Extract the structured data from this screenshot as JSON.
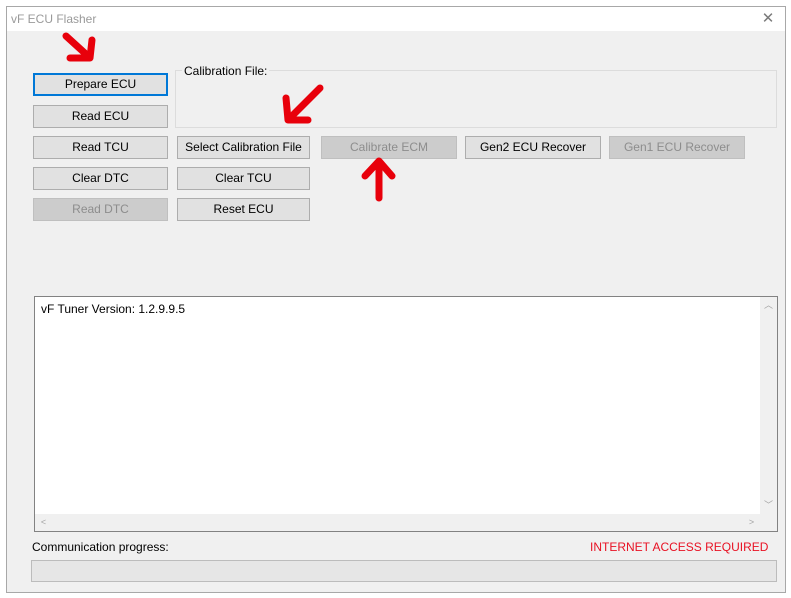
{
  "window": {
    "title": "vF ECU Flasher",
    "close_glyph": "✕"
  },
  "buttons": {
    "prepare_ecu": "Prepare ECU",
    "read_ecu": "Read ECU",
    "read_tcu": "Read TCU",
    "clear_dtc": "Clear DTC",
    "read_dtc": "Read DTC",
    "select_calibration_file": "Select Calibration File",
    "clear_tcu": "Clear TCU",
    "reset_ecu": "Reset ECU",
    "calibrate_ecm": "Calibrate ECM",
    "gen2_ecu_recover": "Gen2 ECU Recover",
    "gen1_ecu_recover": "Gen1 ECU Recover"
  },
  "calibration": {
    "label": "Calibration File:",
    "value": ""
  },
  "log": {
    "lines": [
      "vF Tuner Version: 1.2.9.9.5"
    ]
  },
  "status": {
    "progress_label": "Communication progress:",
    "internet_warning": "INTERNET ACCESS REQUIRED",
    "progress_value": 0
  },
  "colors": {
    "accent": "#0078d7",
    "warning": "#e81123",
    "annotation": "#e8000b"
  },
  "icons": [
    "close-icon",
    "scroll-up-icon",
    "scroll-down-icon",
    "scroll-left-icon",
    "scroll-right-icon",
    "annotation-arrow-icon"
  ]
}
